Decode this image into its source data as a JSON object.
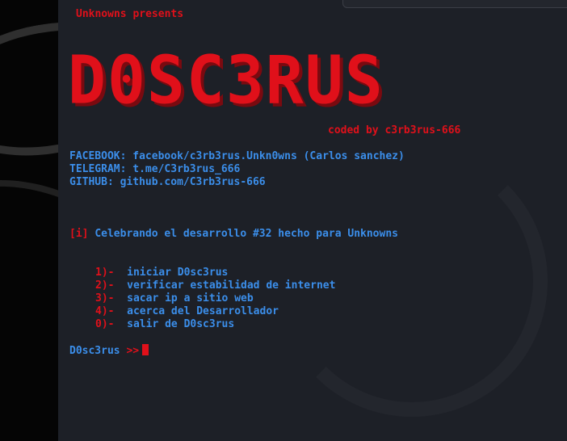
{
  "header": {
    "presents": "Unknowns presents",
    "banner": "D0SC3RUS",
    "coded_by": "coded by c3rb3rus-666"
  },
  "contacts": [
    {
      "label": "FACEBOOK:",
      "value": "facebook/c3rb3rus.Unkn0wns (Carlos sanchez)"
    },
    {
      "label": "TELEGRAM:",
      "value": "t.me/C3rb3rus_666"
    },
    {
      "label": "GITHUB:",
      "value": "github.com/C3rb3rus-666"
    }
  ],
  "info": {
    "tag": "[i]",
    "text": "Celebrando el desarrollo #32 hecho para Unknowns"
  },
  "menu": [
    {
      "num": "1)-",
      "label": "iniciar D0sc3rus"
    },
    {
      "num": "2)-",
      "label": "verificar estabilidad de internet"
    },
    {
      "num": "3)-",
      "label": "sacar ip a sitio web"
    },
    {
      "num": "4)-",
      "label": "acerca del Desarrollador"
    },
    {
      "num": "0)-",
      "label": "salir de D0sc3rus"
    }
  ],
  "prompt": {
    "text": "D0sc3rus",
    "arrows": ">>"
  },
  "colors": {
    "red": "#e0101a",
    "blue": "#3b8eea",
    "terminal_bg": "#1d2027"
  }
}
